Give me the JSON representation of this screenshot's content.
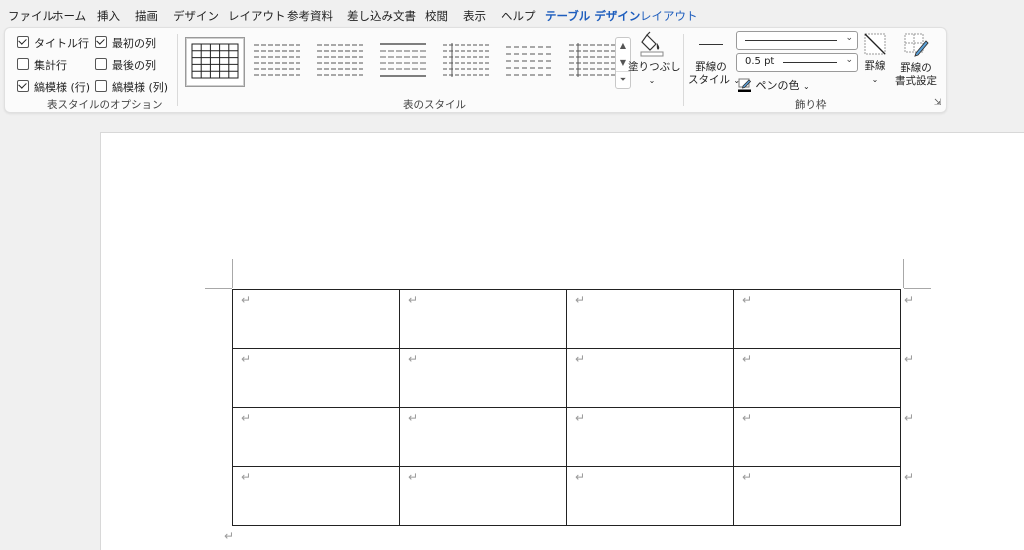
{
  "menu": {
    "tabs": [
      {
        "label": "ファイル"
      },
      {
        "label": "ホーム"
      },
      {
        "label": "挿入"
      },
      {
        "label": "描画"
      },
      {
        "label": "デザイン"
      },
      {
        "label": "レイアウト"
      },
      {
        "label": "参考資料"
      },
      {
        "label": "差し込み文書"
      },
      {
        "label": "校閲"
      },
      {
        "label": "表示"
      },
      {
        "label": "ヘルプ"
      },
      {
        "label": "テーブル デザイン",
        "active": true
      },
      {
        "label": "レイアウト"
      }
    ]
  },
  "ribbon": {
    "style_options": {
      "header_row": {
        "label": "タイトル行",
        "checked": true
      },
      "total_row": {
        "label": "集計行",
        "checked": false
      },
      "banded_rows": {
        "label": "縞模様 (行)",
        "checked": true
      },
      "first_column": {
        "label": "最初の列",
        "checked": true
      },
      "last_column": {
        "label": "最後の列",
        "checked": false
      },
      "banded_columns": {
        "label": "縞模様 (列)",
        "checked": false
      },
      "group_label": "表スタイルのオプション"
    },
    "table_styles": {
      "group_label": "表のスタイル",
      "shading_label": "塗りつぶし"
    },
    "borders": {
      "border_styles_label_1": "罫線の",
      "border_styles_label_2": "スタイル",
      "line_weight": "0.5 pt",
      "pen_color_label": "ペンの色",
      "borders_label": "罫線",
      "border_painter_label_1": "罫線の",
      "border_painter_label_2": "書式設定",
      "group_label": "飾り枠"
    }
  },
  "document": {
    "paragraph_mark": "↵",
    "table": {
      "rows": 4,
      "columns": 4
    }
  },
  "colors": {
    "accent": "#1d5dbd",
    "ribbon_bg": "#fbfbfb",
    "app_bg": "#f0f0f0"
  }
}
